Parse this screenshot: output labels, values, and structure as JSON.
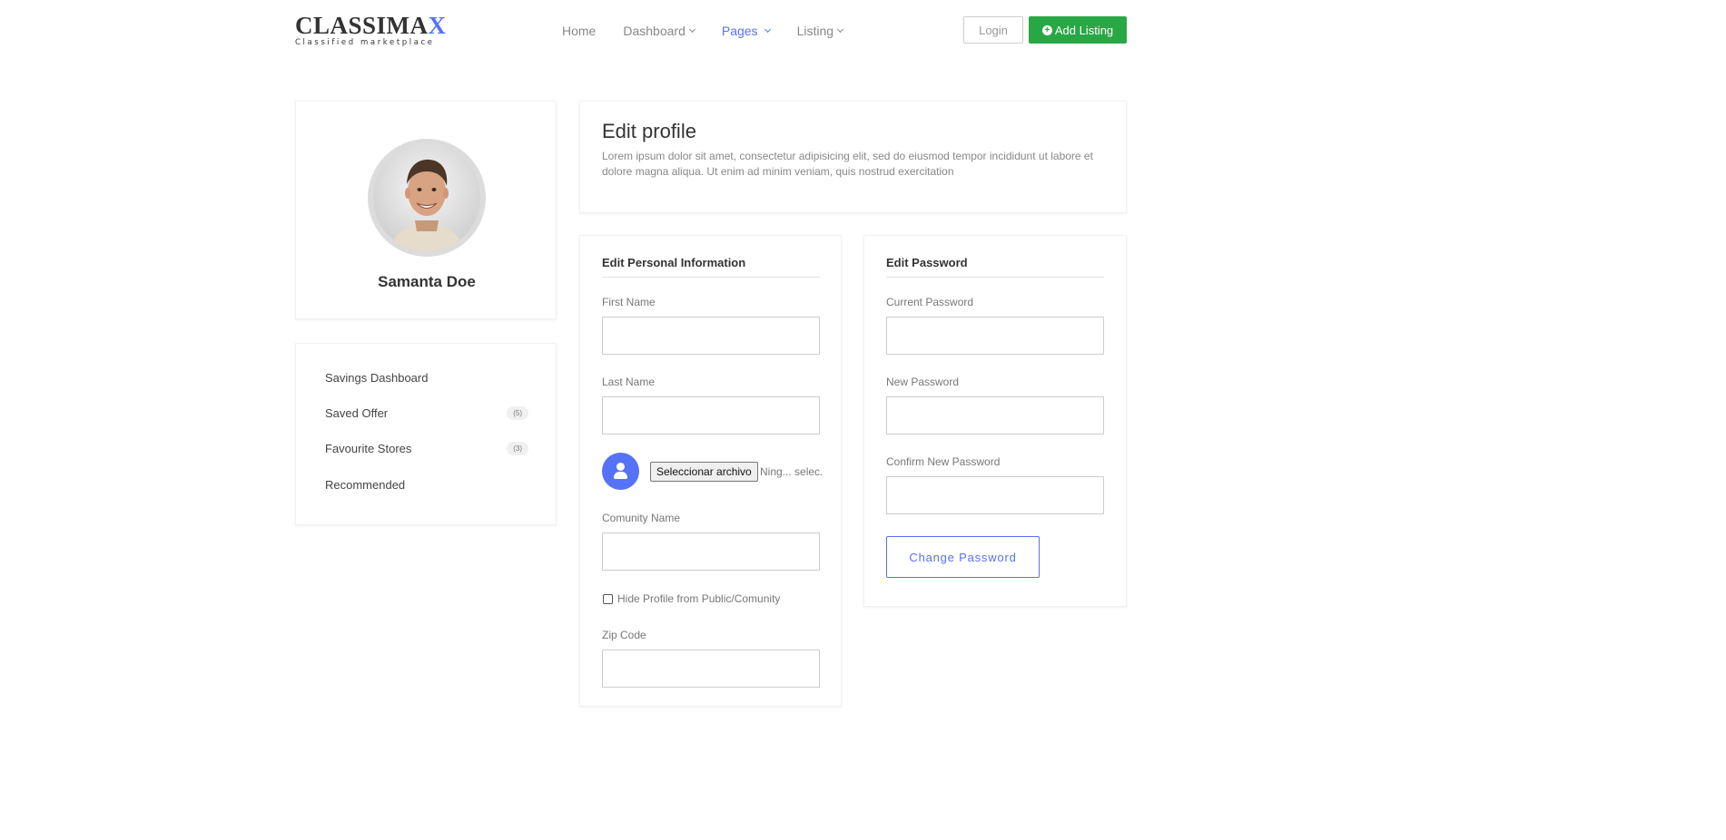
{
  "brand": {
    "name_main": "CLASSIMA",
    "name_accent": "X",
    "tagline": "Classified marketplace"
  },
  "nav": {
    "home": "Home",
    "dashboard": "Dashboard",
    "pages": "Pages",
    "listing": "Listing",
    "login": "Login",
    "add_listing": "Add Listing"
  },
  "profile": {
    "name": "Samanta Doe"
  },
  "menu": [
    {
      "label": "Savings Dashboard",
      "count": ""
    },
    {
      "label": "Saved Offer",
      "count": "(5)"
    },
    {
      "label": "Favourite Stores",
      "count": "(3)"
    },
    {
      "label": "Recommended",
      "count": ""
    }
  ],
  "intro": {
    "title": "Edit profile",
    "text": "Lorem ipsum dolor sit amet, consectetur adipisicing elit, sed do eiusmod tempor incididunt ut labore et dolore magna aliqua. Ut enim ad minim veniam, quis nostrud exercitation"
  },
  "personal": {
    "title": "Edit Personal Information",
    "first_name": {
      "label": "First Name",
      "value": ""
    },
    "last_name": {
      "label": "Last Name",
      "value": ""
    },
    "file_button": "Seleccionar archivo",
    "file_status": "Ning... selec.",
    "community": {
      "label": "Comunity Name",
      "value": ""
    },
    "hide_profile": {
      "label": "Hide Profile from Public/Comunity",
      "checked": false
    },
    "zip": {
      "label": "Zip Code",
      "value": ""
    }
  },
  "password": {
    "title": "Edit Password",
    "current": {
      "label": "Current Password",
      "value": ""
    },
    "new": {
      "label": "New Password",
      "value": ""
    },
    "confirm": {
      "label": "Confirm New Password",
      "value": ""
    },
    "button": "Change Password"
  },
  "colors": {
    "accent": "#5672f9",
    "success": "#28a745",
    "muted_text": "#888888"
  },
  "icons": [
    "chevron-down-icon",
    "plus-circle-icon",
    "user-icon"
  ]
}
